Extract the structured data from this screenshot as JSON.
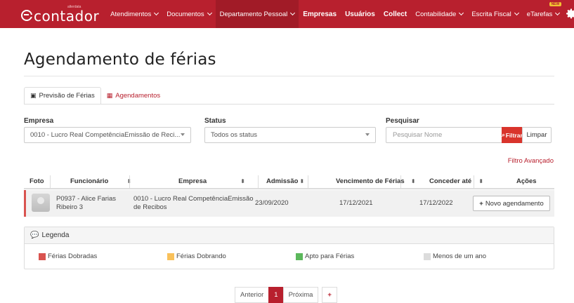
{
  "navbar": {
    "logo_text": "contador",
    "logo_sup": "alterdata",
    "items": [
      {
        "label": "Atendimentos",
        "dropdown": true
      },
      {
        "label": "Documentos",
        "dropdown": true
      },
      {
        "label": "Departamento Pessoal",
        "dropdown": true,
        "active": true
      },
      {
        "label": "Empresas",
        "dropdown": false
      },
      {
        "label": "Usuários",
        "dropdown": false
      },
      {
        "label": "Collect",
        "dropdown": false
      },
      {
        "label": "Contabilidade",
        "dropdown": true
      },
      {
        "label": "Escrita Fiscal",
        "dropdown": true
      },
      {
        "label": "eTarefas",
        "dropdown": true,
        "badge": "NEW"
      }
    ],
    "icons": [
      "gear-icon",
      "user-icon"
    ]
  },
  "page": {
    "title": "Agendamento de férias"
  },
  "tabs": [
    {
      "label": "Previsão de Férias",
      "icon": "calendar-icon",
      "active": true
    },
    {
      "label": "Agendamentos",
      "icon": "calendar-check-icon",
      "active": false
    }
  ],
  "filters": {
    "empresa_label": "Empresa",
    "empresa_value": "0010 - Lucro Real CompetênciaEmissão de Reci...",
    "status_label": "Status",
    "status_value": "Todos os status",
    "pesquisar_label": "Pesquisar",
    "search_placeholder": "Pesquisar Nome",
    "filter_button": "Filtrar",
    "clear_button": "Limpar",
    "advanced_filter": "Filtro Avançado"
  },
  "table": {
    "headers": {
      "foto": "Foto",
      "funcionario": "Funcionário",
      "empresa": "Empresa",
      "admissao": "Admissão",
      "vencimento": "Vencimento de Férias",
      "conceder": "Conceder até",
      "acoes": "Ações"
    },
    "rows": [
      {
        "funcionario_l1": "P0937 - Alice Farias",
        "funcionario_l2": "Ribeiro 3",
        "empresa_l1": "0010 - Lucro Real CompetênciaEmissão",
        "empresa_l2": "de Recibos",
        "admissao": "23/09/2020",
        "vencimento": "17/12/2021",
        "conceder": "17/12/2022",
        "action": "Novo agendamento",
        "status_color": "#d9534f"
      }
    ]
  },
  "legend": {
    "title": "Legenda",
    "items": [
      {
        "label": "Férias Dobradas",
        "color": "#d9534f"
      },
      {
        "label": "Férias Dobrando",
        "color": "#f9c15b"
      },
      {
        "label": "Apto para Férias",
        "color": "#5cb85c"
      },
      {
        "label": "Menos de um ano",
        "color": "#dcdcdc"
      }
    ]
  },
  "pagination": {
    "prev": "Anterior",
    "current": "1",
    "next": "Próxima",
    "add": "+"
  }
}
